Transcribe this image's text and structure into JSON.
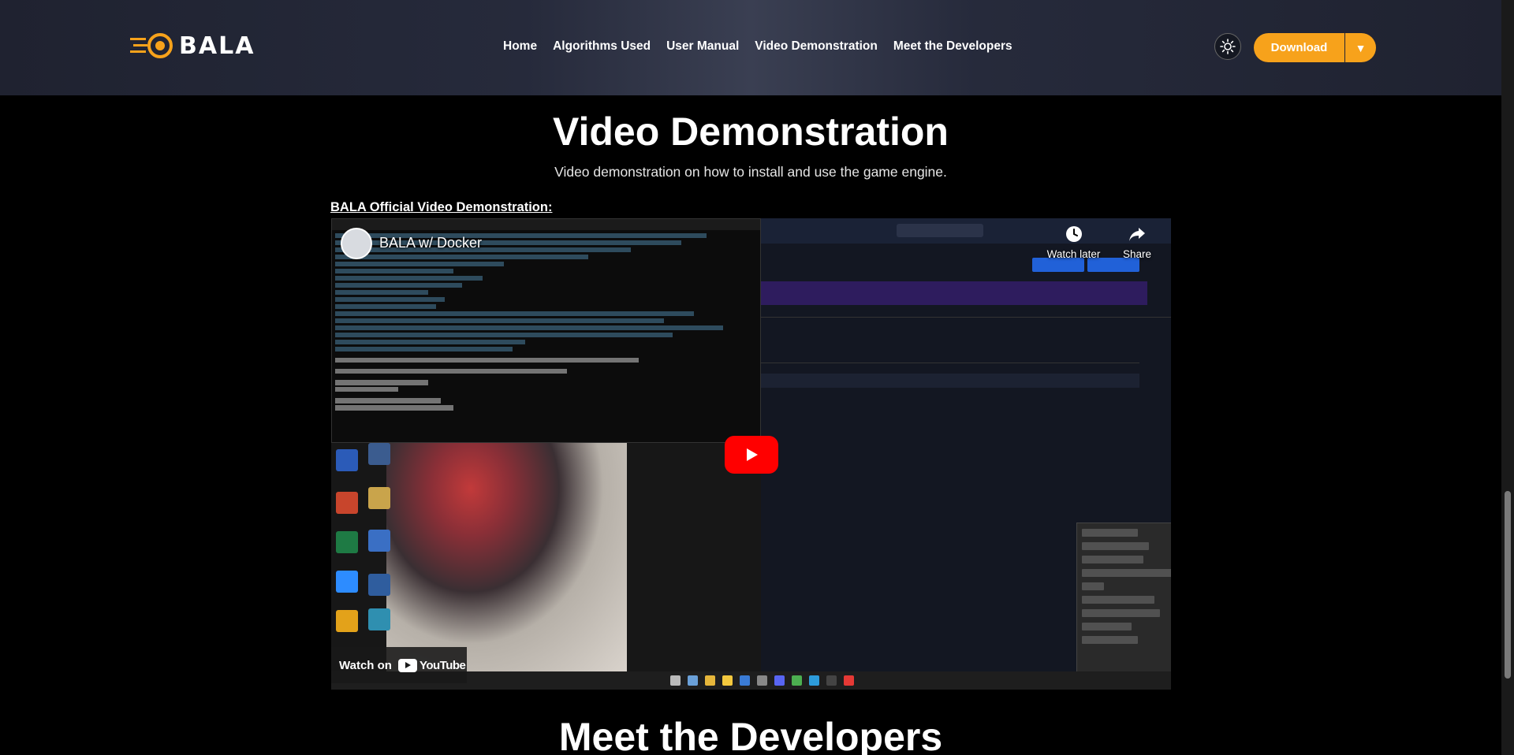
{
  "brand": {
    "name": "BALA"
  },
  "nav": {
    "links": [
      "Home",
      "Algorithms Used",
      "User Manual",
      "Video Demonstration",
      "Meet the Developers"
    ],
    "download_label": "Download"
  },
  "video_section": {
    "title": "Video Demonstration",
    "subtitle": "Video demonstration on how to install and use the game engine.",
    "link_label": "BALA Official Video Demonstration:",
    "video": {
      "title": "BALA w/ Docker",
      "watch_later": "Watch later",
      "share": "Share",
      "watch_on": "Watch on",
      "platform": "YouTube"
    }
  },
  "next_section": {
    "title": "Meet the Developers"
  },
  "colors": {
    "accent": "#f7a21b",
    "youtube_red": "#ff0000",
    "background": "#000000"
  },
  "icons": [
    "bala-logo-icon",
    "sun-icon",
    "chevron-down-icon",
    "clock-icon",
    "share-icon",
    "play-icon",
    "youtube-logo-icon"
  ]
}
